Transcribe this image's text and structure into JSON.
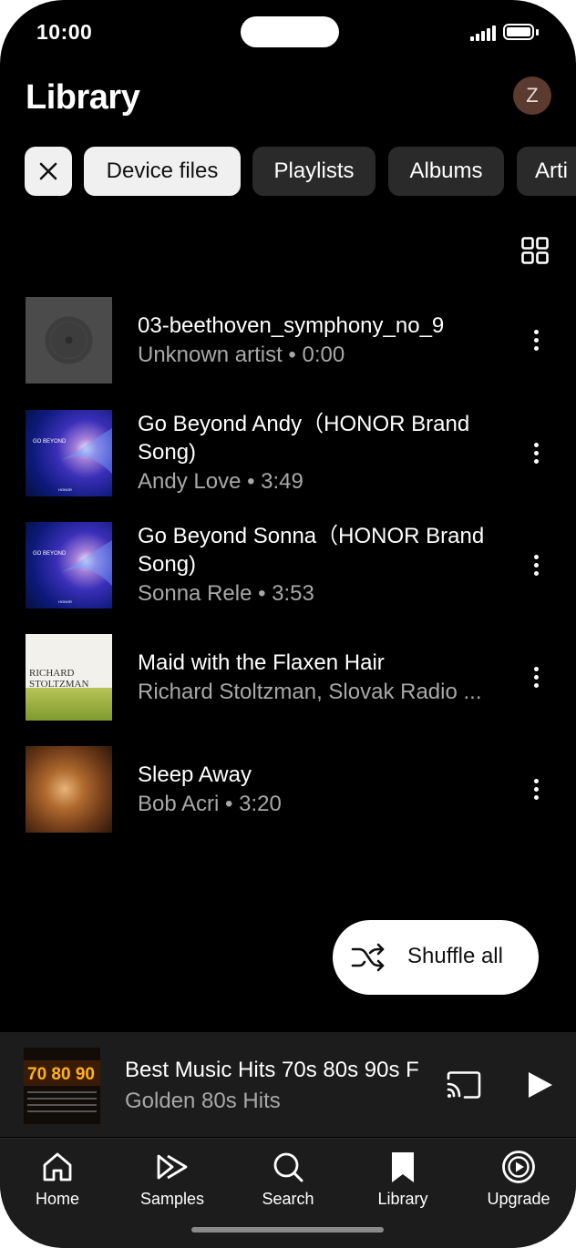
{
  "status_bar": {
    "time": "10:00"
  },
  "header": {
    "title": "Library",
    "avatar_initial": "Z"
  },
  "filters": {
    "chips": [
      {
        "label": "Device files",
        "selected": true
      },
      {
        "label": "Playlists",
        "selected": false
      },
      {
        "label": "Albums",
        "selected": false
      },
      {
        "label": "Arti",
        "selected": false
      }
    ]
  },
  "tracks": [
    {
      "title": "03-beethoven_symphony_no_9",
      "subtitle": "Unknown artist • 0:00",
      "art": "placeholder-disc"
    },
    {
      "title": "Go Beyond Andy（HONOR Brand Song)",
      "subtitle": "Andy Love • 3:49",
      "art": "go-beyond-cover",
      "art_text": "GO BEYOND",
      "art_brand": "HONOR"
    },
    {
      "title": "Go Beyond Sonna（HONOR Brand Song)",
      "subtitle": "Sonna Rele • 3:53",
      "art": "go-beyond-cover",
      "art_text": "GO BEYOND",
      "art_brand": "HONOR"
    },
    {
      "title": "Maid with the Flaxen Hair",
      "subtitle": "Richard Stoltzman, Slovak Radio ...",
      "art": "stoltzman-cover",
      "art_text_1": "RICHARD",
      "art_text_2": "STOLTZMAN"
    },
    {
      "title": "Sleep Away",
      "subtitle": "Bob Acri • 3:20",
      "art": "piano-cover"
    }
  ],
  "shuffle": {
    "label": "Shuffle all"
  },
  "mini_player": {
    "title": "Best Music Hits 70s 80s 90s F",
    "subtitle": "Golden 80s Hits",
    "art_text": "70 80 90",
    "state": "paused"
  },
  "bottom_nav": [
    {
      "label": "Home",
      "icon": "home-icon"
    },
    {
      "label": "Samples",
      "icon": "samples-icon"
    },
    {
      "label": "Search",
      "icon": "search-icon"
    },
    {
      "label": "Library",
      "icon": "library-icon",
      "active": true
    },
    {
      "label": "Upgrade",
      "icon": "upgrade-icon"
    }
  ],
  "colors": {
    "background": "#000000",
    "surface": "#1c1c1c",
    "chip": "#2a2a2a",
    "chip_selected": "#f0f0f0",
    "secondary_text": "#a8a8a8"
  }
}
